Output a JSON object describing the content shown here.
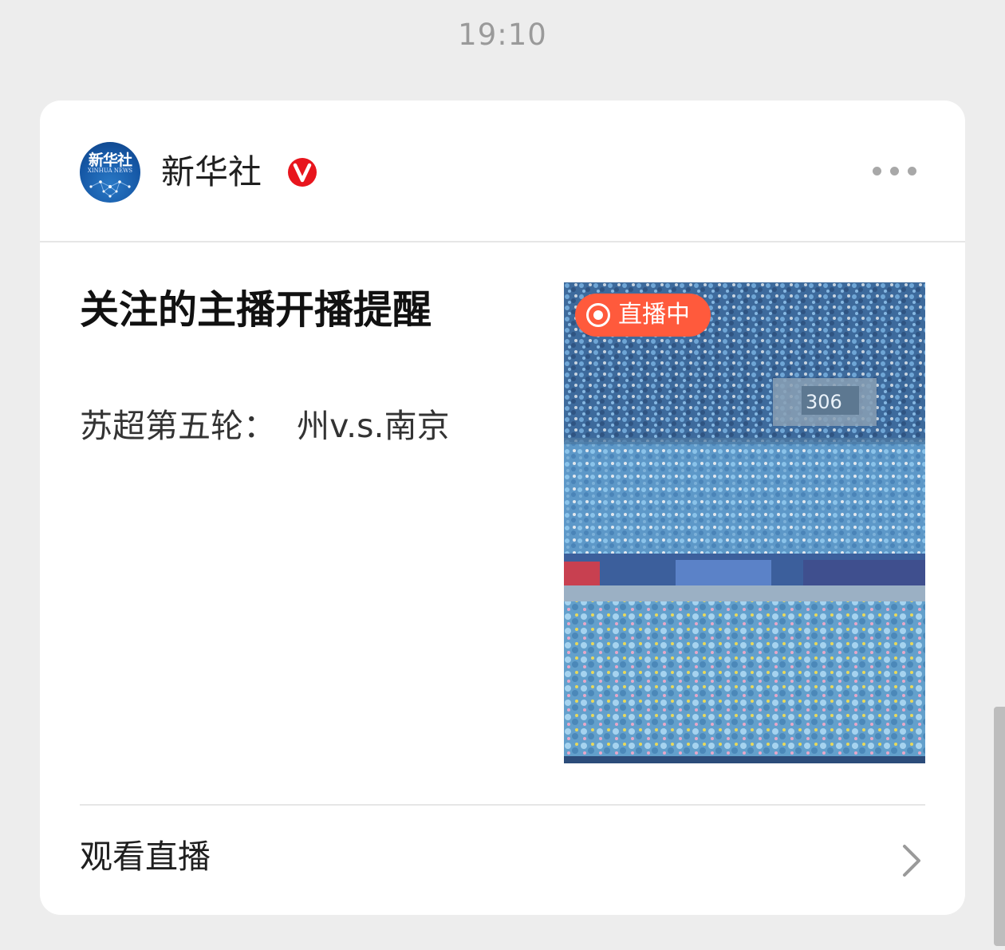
{
  "status_time": "19:10",
  "account": {
    "name": "新华社",
    "avatar_cn": "新华社",
    "avatar_en": "XINHUA NEWS",
    "verified_icon": "verified-v-icon",
    "verified_text": "V",
    "more_icon": "more-dots-icon"
  },
  "notification": {
    "title": "关注的主播开播提醒",
    "subtitle": "苏超第五轮：  州v.s.南京",
    "live_badge": "直播中",
    "thumbnail_image": "stadium-crowd-in-rain",
    "thumbnail_sign": "306"
  },
  "actions": {
    "watch_label": "观看直播",
    "chevron_icon": "chevron-right-icon"
  },
  "colors": {
    "live_badge": "#ff5a3c",
    "verified": "#e8151d",
    "background": "#ededed",
    "card": "#ffffff"
  }
}
